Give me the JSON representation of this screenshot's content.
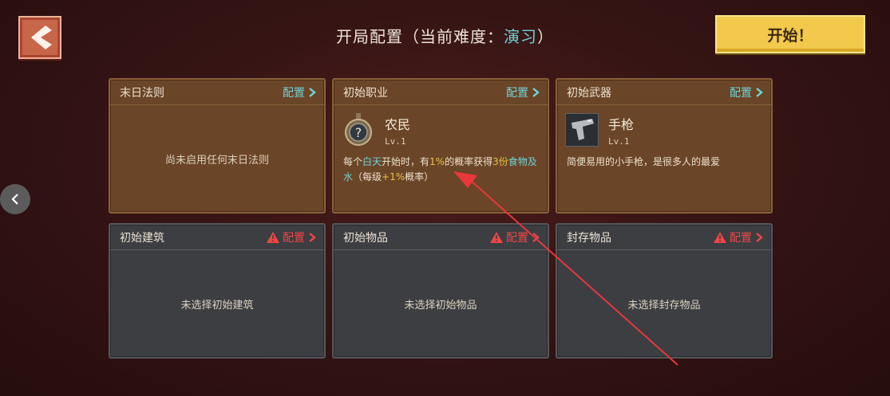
{
  "header": {
    "title_prefix": "开局配置（当前难度：",
    "difficulty": "演习",
    "title_suffix": "）",
    "start_label": "开始！"
  },
  "cards": {
    "doom_rules": {
      "title": "末日法则",
      "config_label": "配置",
      "empty_text": "尚未启用任何末日法则"
    },
    "profession": {
      "title": "初始职业",
      "config_label": "配置",
      "name": "农民",
      "level": "Lv.1",
      "desc": [
        "每个",
        "白天",
        "开始时，有",
        "1%",
        "的概率获得",
        "3份",
        "食物及水",
        "（每级",
        "+1%",
        "概率）"
      ]
    },
    "weapon": {
      "title": "初始武器",
      "config_label": "配置",
      "name": "手枪",
      "level": "Lv.1",
      "desc": "简便易用的小手枪，是很多人的最爱"
    },
    "building": {
      "title": "初始建筑",
      "config_label": "配置",
      "empty_text": "未选择初始建筑"
    },
    "items": {
      "title": "初始物品",
      "config_label": "配置",
      "empty_text": "未选择初始物品"
    },
    "stored": {
      "title": "封存物品",
      "config_label": "配置",
      "empty_text": "未选择封存物品"
    }
  },
  "colors": {
    "accent_teal": "#6fd3d8",
    "warn_red": "#f04545",
    "highlight_yellow": "#e9c249",
    "start_yellow": "#f2c94c"
  },
  "icons": [
    "back-arrow-icon",
    "chevron-left-icon",
    "chevron-right-icon",
    "warning-triangle-icon",
    "profession-medal-icon",
    "pistol-icon"
  ]
}
